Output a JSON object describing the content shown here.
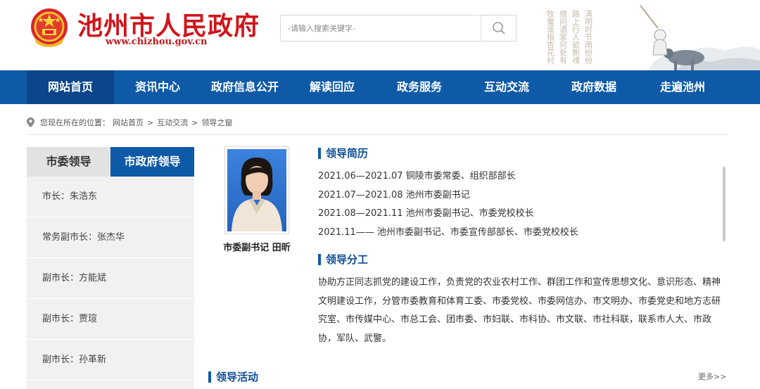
{
  "header": {
    "site_title": "池州市人民政府",
    "site_url": "www.chizhou.gov.cn",
    "search_placeholder": "-请输入搜索关键字-",
    "art_poem": [
      "清明时节雨纷纷",
      "路上行人欲断魂",
      "借问酒家何处有",
      "牧童遥指杏花村"
    ]
  },
  "nav": {
    "items": [
      "网站首页",
      "资讯中心",
      "政府信息公开",
      "解读回应",
      "政务服务",
      "互动交流",
      "政府数据",
      "走遍池州"
    ],
    "active_index": 0
  },
  "breadcrumb": {
    "prefix": "您现在所在的位置：",
    "items": [
      "网站首页",
      "互动交流",
      "领导之窗"
    ],
    "separator": ">"
  },
  "sidebar": {
    "tabs": [
      "市委领导",
      "市政府领导"
    ],
    "active_tab": 1,
    "items": [
      "市长：朱浩东",
      "常务副市长：张杰华",
      "副市长：方能斌",
      "副市长：贾瑄",
      "副市长：孙革新"
    ]
  },
  "leader": {
    "caption": "市委副书记 田昕"
  },
  "resume": {
    "title": "领导简历",
    "rows": [
      "2021.06—2021.07  铜陵市委常委、组织部部长",
      "2021.07—2021.08  池州市委副书记",
      "2021.08—2021.11  池州市委副书记、市委党校校长",
      "2021.11—— 池州市委副书记、市委宣传部部长、市委党校校长"
    ]
  },
  "duty": {
    "title": "领导分工",
    "text": "协助方正同志抓党的建设工作，负责党的农业农村工作、群团工作和宣传思想文化、意识形态、精神文明建设工作，分管市委教育和体育工委、市委党校、市委网信办、市文明办、市委党史和地方志研究室、市传媒中心、市总工会、团市委、市妇联、市科协、市文联、市社科联，联系市人大、市政协，军队、武警。"
  },
  "activity": {
    "title": "领导活动",
    "more": "更多>>"
  },
  "colors": {
    "brand_blue": "#0e5aa7",
    "title_red": "#d0151b",
    "nav_active": "#0a4689"
  }
}
